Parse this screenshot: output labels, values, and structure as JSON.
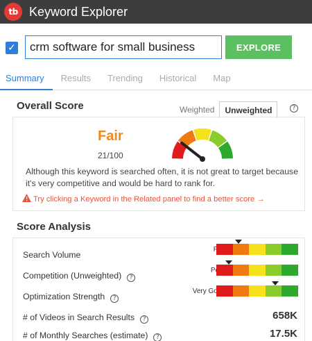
{
  "app": {
    "title": "Keyword Explorer",
    "logo_text": "tb"
  },
  "search": {
    "checked": true,
    "value": "crm software for small business",
    "button_label": "EXPLORE"
  },
  "tabs": [
    {
      "label": "Summary",
      "active": true
    },
    {
      "label": "Results",
      "active": false
    },
    {
      "label": "Trending",
      "active": false
    },
    {
      "label": "Historical",
      "active": false
    },
    {
      "label": "Map",
      "active": false
    }
  ],
  "overall": {
    "title": "Overall Score",
    "toggle": {
      "weighted": "Weighted",
      "unweighted": "Unweighted",
      "selected": "Unweighted"
    },
    "rating": "Fair",
    "score": "21/100",
    "gauge_value": 21,
    "description": "Although this keyword is searched often, it is not great to target because it's very competitive and would be hard to rank for.",
    "tip": "Try clicking a Keyword in the Related panel to find a better score →"
  },
  "analysis": {
    "title": "Score Analysis",
    "rows": [
      {
        "label": "Search Volume",
        "rating": "Fair",
        "level": 0.27,
        "help": false
      },
      {
        "label": "Competition (Unweighted)",
        "rating": "Poor",
        "level": 0.15,
        "help": true
      },
      {
        "label": "Optimization Strength",
        "rating": "Very Good",
        "level": 0.72,
        "help": true
      }
    ],
    "stats": [
      {
        "label": "# of Videos in Search Results",
        "value": "658K"
      },
      {
        "label": "# of Monthly Searches (estimate)",
        "value": "17.5K"
      }
    ]
  },
  "colors": {
    "accent": "#2f7fd8",
    "explore": "#5cbf60",
    "fair": "#f08a1c",
    "warning": "#e8543a",
    "scale": [
      "#e01b1b",
      "#f07a10",
      "#f5e11c",
      "#8acd2a",
      "#2daa2d"
    ]
  }
}
